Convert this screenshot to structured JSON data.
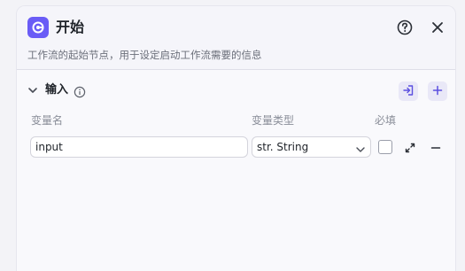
{
  "node": {
    "title": "开始",
    "description": "工作流的起始节点，用于设定启动工作流需要的信息",
    "icon": "start-node-icon",
    "accent": "#6a5cf6"
  },
  "header_actions": {
    "help_icon": "question-circle-icon",
    "close_icon": "close-icon"
  },
  "input_section": {
    "title": "输入",
    "info_icon": "info-icon",
    "import_icon": "import-icon",
    "add_icon": "plus-icon",
    "columns": {
      "name": "变量名",
      "type": "变量类型",
      "required": "必填"
    },
    "rows": [
      {
        "name": "input",
        "type": "str. String",
        "required": false
      }
    ]
  }
}
